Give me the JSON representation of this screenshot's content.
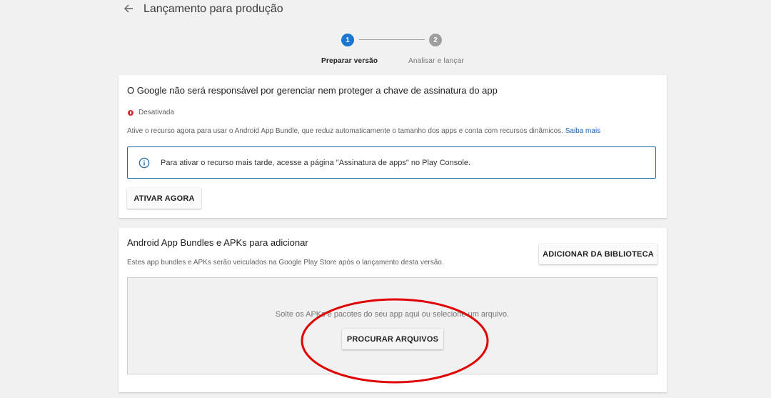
{
  "header": {
    "title": "Lançamento para produção"
  },
  "stepper": {
    "step1_number": "1",
    "step1_label": "Preparar versão",
    "step2_number": "2",
    "step2_label": "Analisar e lançar"
  },
  "signing_card": {
    "title": "O Google não será responsável por gerenciar nem proteger a chave de assinatura do app",
    "status": "Desativada",
    "description": "Ative o recurso agora para usar o Android App Bundle, que reduz automaticamente o tamanho dos apps e conta com recursos dinâmicos.",
    "learn_more": "Saiba mais",
    "info_text": "Para ativar o recurso mais tarde, acesse a página \"Assinatura de apps\" no Play Console.",
    "activate_button": "ATIVAR AGORA"
  },
  "bundles_card": {
    "title": "Android App Bundles e APKs para adicionar",
    "description": "Estes app bundles e APKs serão veiculados na Google Play Store após o lançamento desta versão.",
    "library_button": "ADICIONAR DA BIBLIOTECA",
    "drop_text": "Solte os APKs e pacotes do seu app aqui ou selecione um arquivo.",
    "browse_button": "PROCURAR ARQUIVOS"
  },
  "colors": {
    "accent": "#1976d2",
    "status_error": "#d32f2f",
    "annotation": "#e00000"
  },
  "icons": {
    "back": "arrow-back-icon",
    "info": "info-icon",
    "status": "error-dot-icon"
  }
}
